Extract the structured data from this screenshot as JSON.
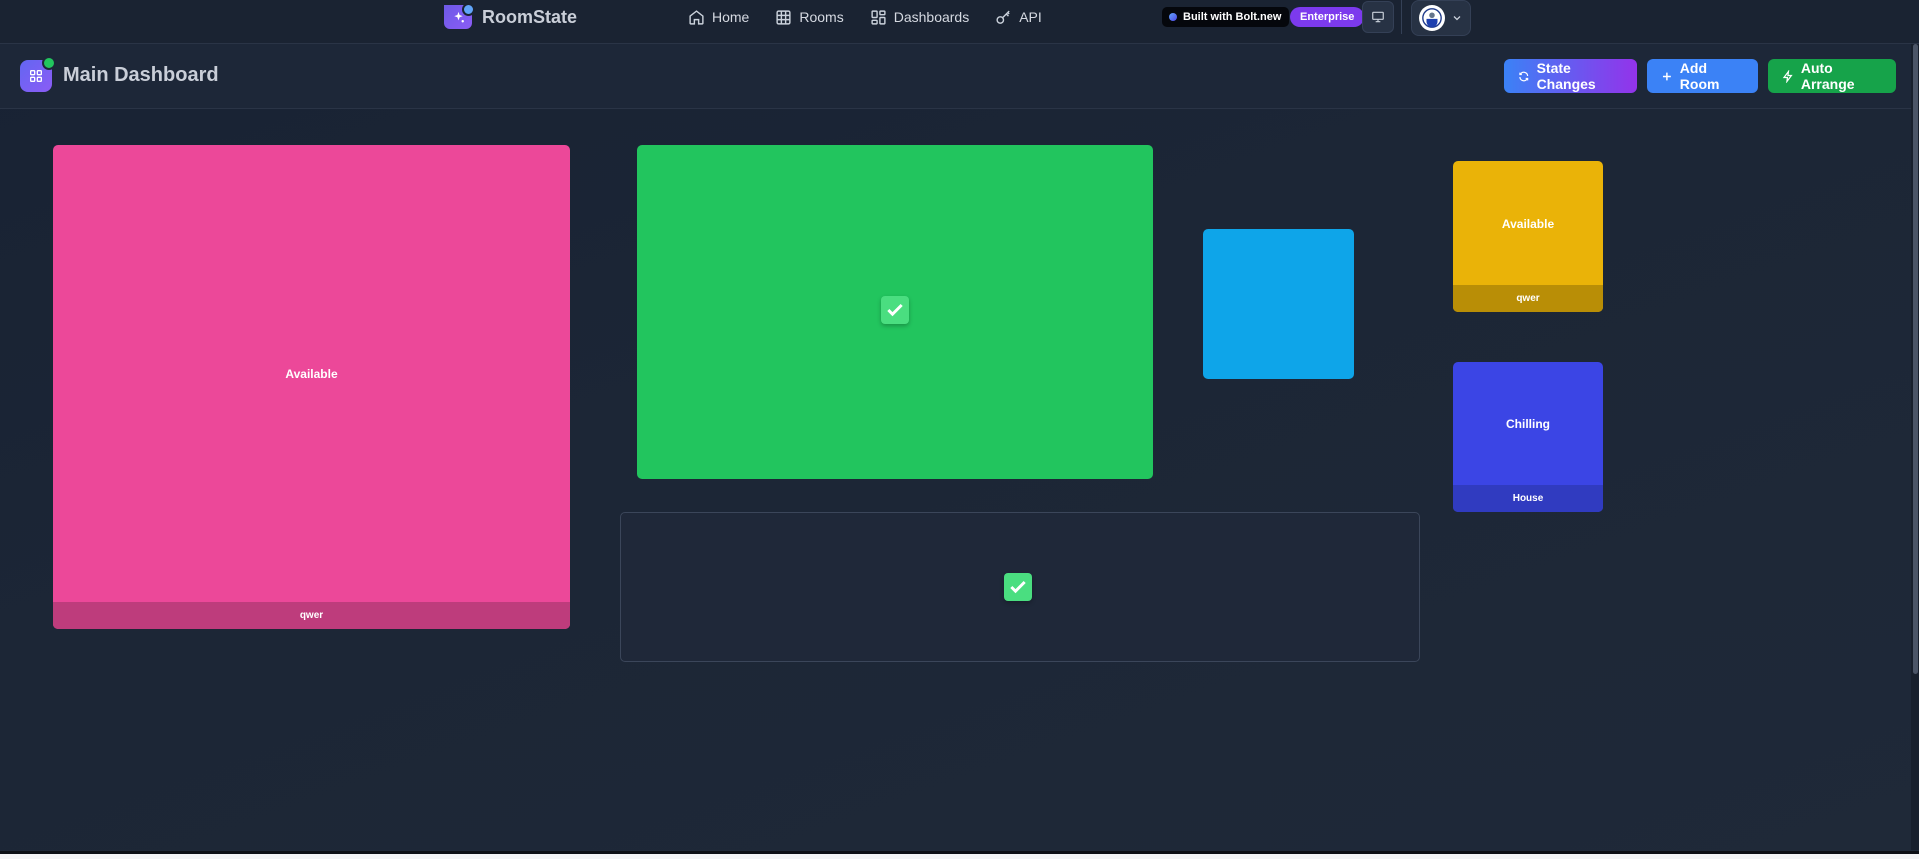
{
  "app": {
    "name": "RoomState"
  },
  "nav": {
    "links": [
      {
        "label": "Home",
        "icon": "home-icon"
      },
      {
        "label": "Rooms",
        "icon": "grid-icon"
      },
      {
        "label": "Dashboards",
        "icon": "dashboard-icon"
      },
      {
        "label": "API",
        "icon": "key-icon"
      }
    ],
    "bolt_badge": "Built with Bolt.new",
    "plan_badge": "Enterprise"
  },
  "header": {
    "title": "Main Dashboard",
    "buttons": {
      "state_changes": "State Changes",
      "add_room": "Add Room",
      "auto_arrange": "Auto Arrange"
    }
  },
  "rooms": [
    {
      "status": "Available",
      "name": "qwer",
      "color": "#ec4899"
    },
    {
      "status": "",
      "name": "",
      "color": "#22c55e",
      "checked": true
    },
    {
      "status": "",
      "name": "",
      "color": "#0ea5e9"
    },
    {
      "status": "Available",
      "name": "qwer",
      "color": "#eab308"
    },
    {
      "status": "Chilling",
      "name": "House",
      "color": "#3b45e5"
    },
    {
      "status": "",
      "name": "",
      "color": "#1f2839",
      "checked": true
    }
  ],
  "colors": {
    "accent_purple": "#7c3aed",
    "accent_blue": "#3b82f6",
    "accent_green": "#16a34a",
    "background": "#1c2636"
  }
}
